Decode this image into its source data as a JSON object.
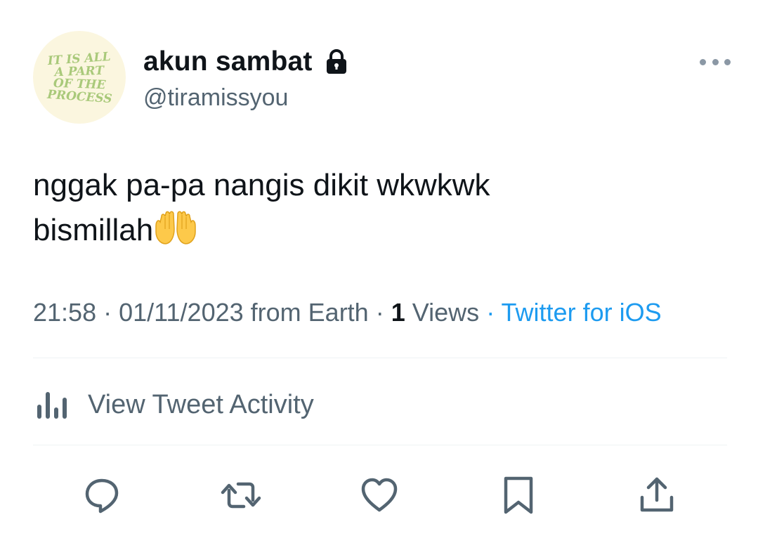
{
  "author": {
    "display_name": "akun sambat",
    "handle": "@tiramissyou",
    "avatar_text": [
      "IT IS ALL",
      "A PART",
      "OF THE",
      "PROCESS"
    ],
    "protected_icon": "lock-icon"
  },
  "tweet": {
    "line1": "nggak pa-pa nangis dikit wkwkwk",
    "line2": "bismillah",
    "emoji": "palms-up-together-emoji"
  },
  "meta": {
    "time": "21:58",
    "date": "01/11/2023",
    "location": "from Earth",
    "sep": "·",
    "views_count": "1",
    "views_label": "Views",
    "source": "Twitter for iOS"
  },
  "activity": {
    "label": "View Tweet Activity",
    "icon": "bar-chart-icon"
  },
  "actions": [
    {
      "name": "reply",
      "icon": "reply-icon"
    },
    {
      "name": "retweet",
      "icon": "retweet-icon"
    },
    {
      "name": "like",
      "icon": "heart-icon"
    },
    {
      "name": "bookmark",
      "icon": "bookmark-icon"
    },
    {
      "name": "share",
      "icon": "share-icon"
    }
  ],
  "colors": {
    "text_primary": "#0f1419",
    "text_secondary": "#536471",
    "link": "#1d9bf0",
    "avatar_bg": "#fbf6df",
    "avatar_text": "#a9c97a",
    "divider": "#eff3f4"
  }
}
